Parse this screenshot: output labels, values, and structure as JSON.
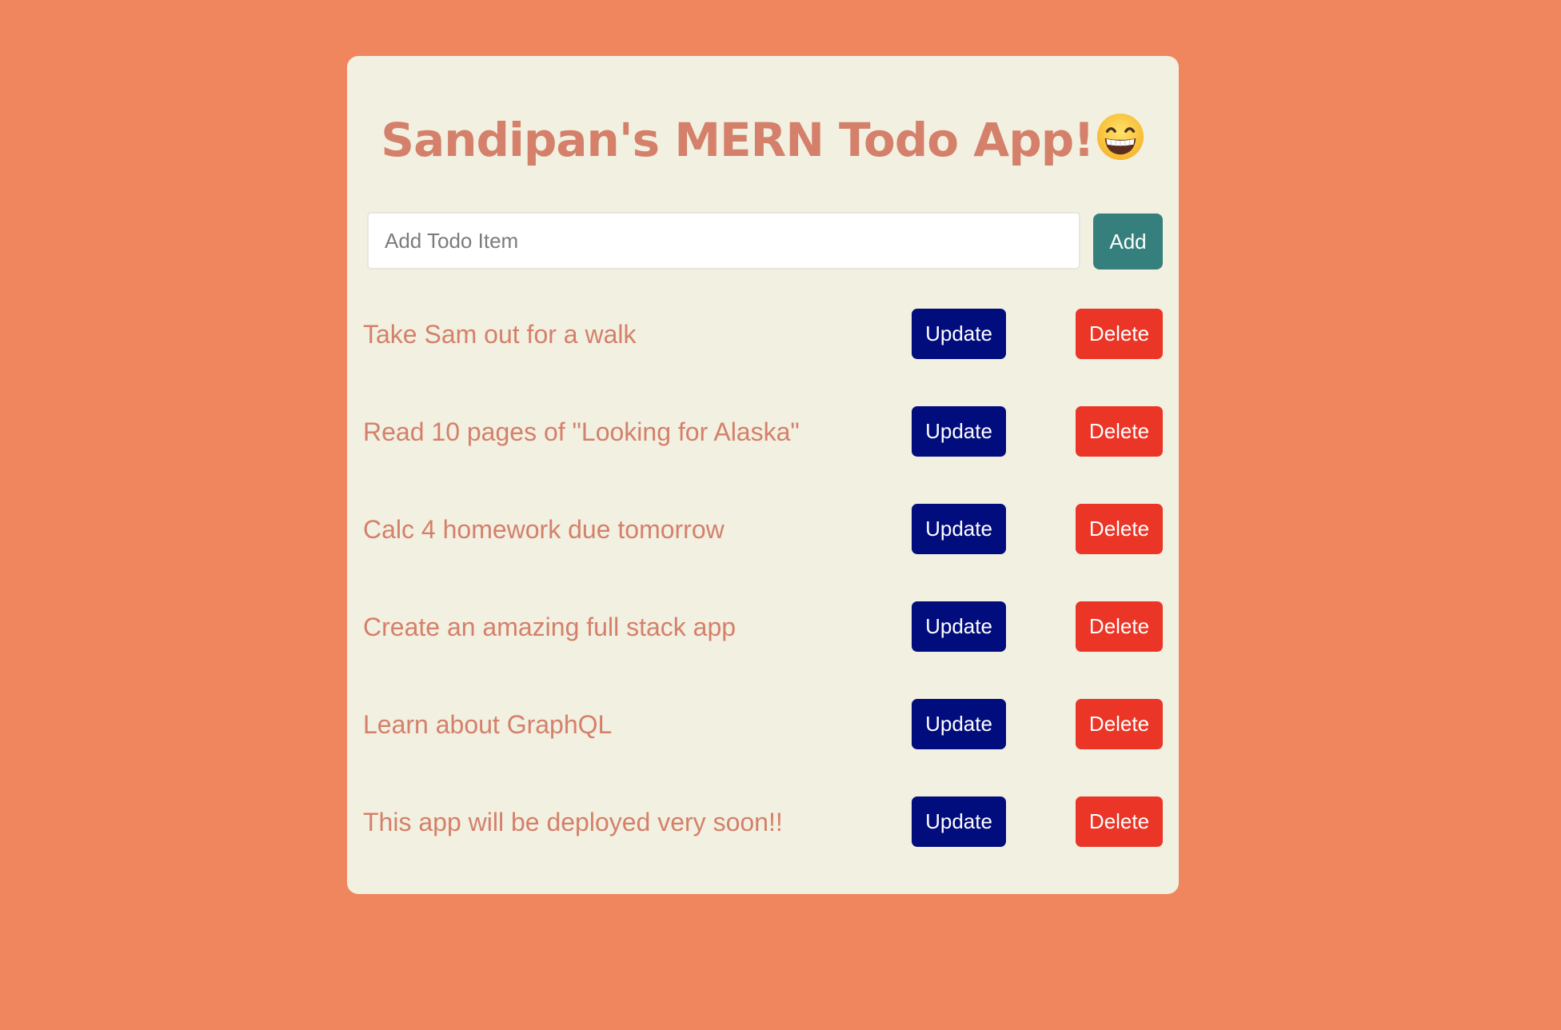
{
  "app": {
    "title": "Sandipan's MERN Todo App!",
    "title_emoji_icon": "grinning-face-emoji"
  },
  "add_form": {
    "placeholder": "Add Todo Item",
    "value": "",
    "add_label": "Add"
  },
  "todos": [
    {
      "text": "Take Sam out for a walk",
      "update_label": "Update",
      "delete_label": "Delete"
    },
    {
      "text": "Read 10 pages of \"Looking for Alaska\"",
      "update_label": "Update",
      "delete_label": "Delete"
    },
    {
      "text": "Calc 4 homework due tomorrow",
      "update_label": "Update",
      "delete_label": "Delete"
    },
    {
      "text": "Create an amazing full stack app",
      "update_label": "Update",
      "delete_label": "Delete"
    },
    {
      "text": "Learn about GraphQL",
      "update_label": "Update",
      "delete_label": "Delete"
    },
    {
      "text": "This app will be deployed very soon!!",
      "update_label": "Update",
      "delete_label": "Delete"
    }
  ],
  "colors": {
    "background": "#f0865e",
    "card": "#f2f0e1",
    "accent_text": "#d4806a",
    "add_button": "#35807d",
    "update_button": "#010c7d",
    "delete_button": "#eb3526"
  }
}
